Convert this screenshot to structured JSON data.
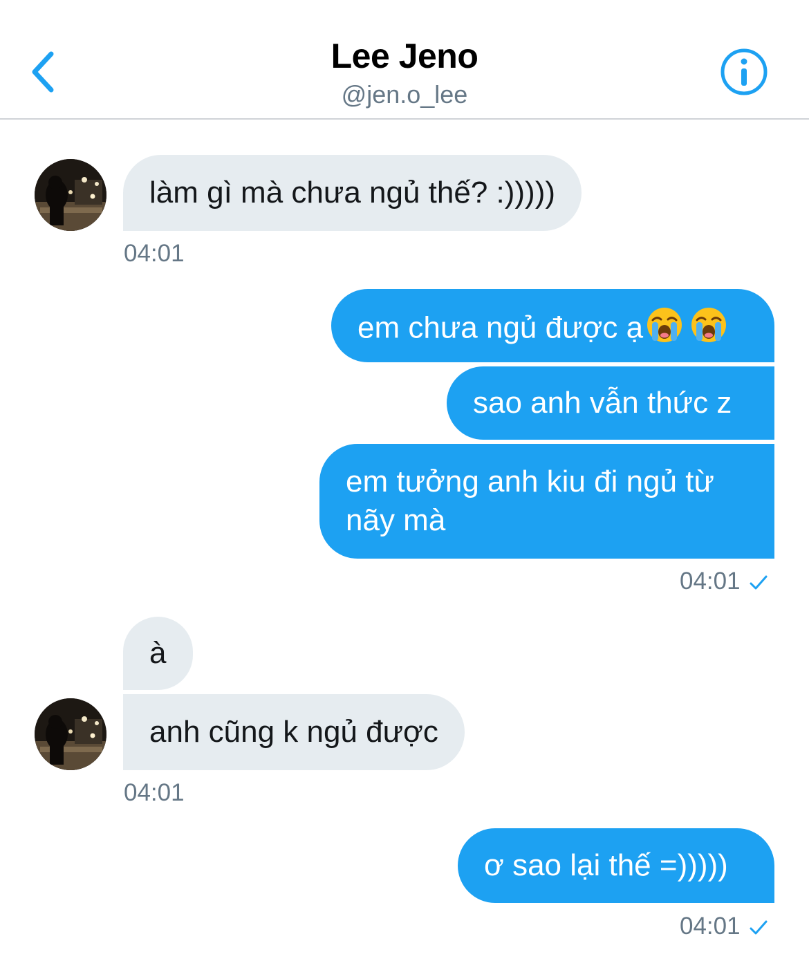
{
  "header": {
    "title": "Lee Jeno",
    "handle": "@jen.o_lee"
  },
  "colors": {
    "accent": "#1da1f2",
    "incoming_bubble": "#e6ecf0",
    "timestamp": "#657786"
  },
  "icons": {
    "back": "chevron-left-icon",
    "info": "info-circle-icon",
    "read": "check-icon",
    "crying": "loudly-crying-face-emoji"
  },
  "messages": [
    {
      "id": "m1",
      "direction": "incoming",
      "text": "làm gì mà chưa ngủ thế? :)))))"
    },
    {
      "id": "m2",
      "direction": "outgoing",
      "text": "em chưa ngủ được ạ",
      "emoji_count": 2
    },
    {
      "id": "m3",
      "direction": "outgoing",
      "text": "sao anh vẫn thức z"
    },
    {
      "id": "m4",
      "direction": "outgoing",
      "line1": "em tưởng anh kiu đi ngủ từ",
      "line2": "nãy mà"
    },
    {
      "id": "m5",
      "direction": "incoming",
      "text": "à"
    },
    {
      "id": "m6",
      "direction": "incoming",
      "text": "anh cũng k ngủ được"
    },
    {
      "id": "m7",
      "direction": "outgoing",
      "text": "ơ sao lại thế =)))))"
    }
  ],
  "timestamps": {
    "t1": "04:01",
    "t2": "04:01",
    "t3": "04:01",
    "t4": "04:01"
  }
}
